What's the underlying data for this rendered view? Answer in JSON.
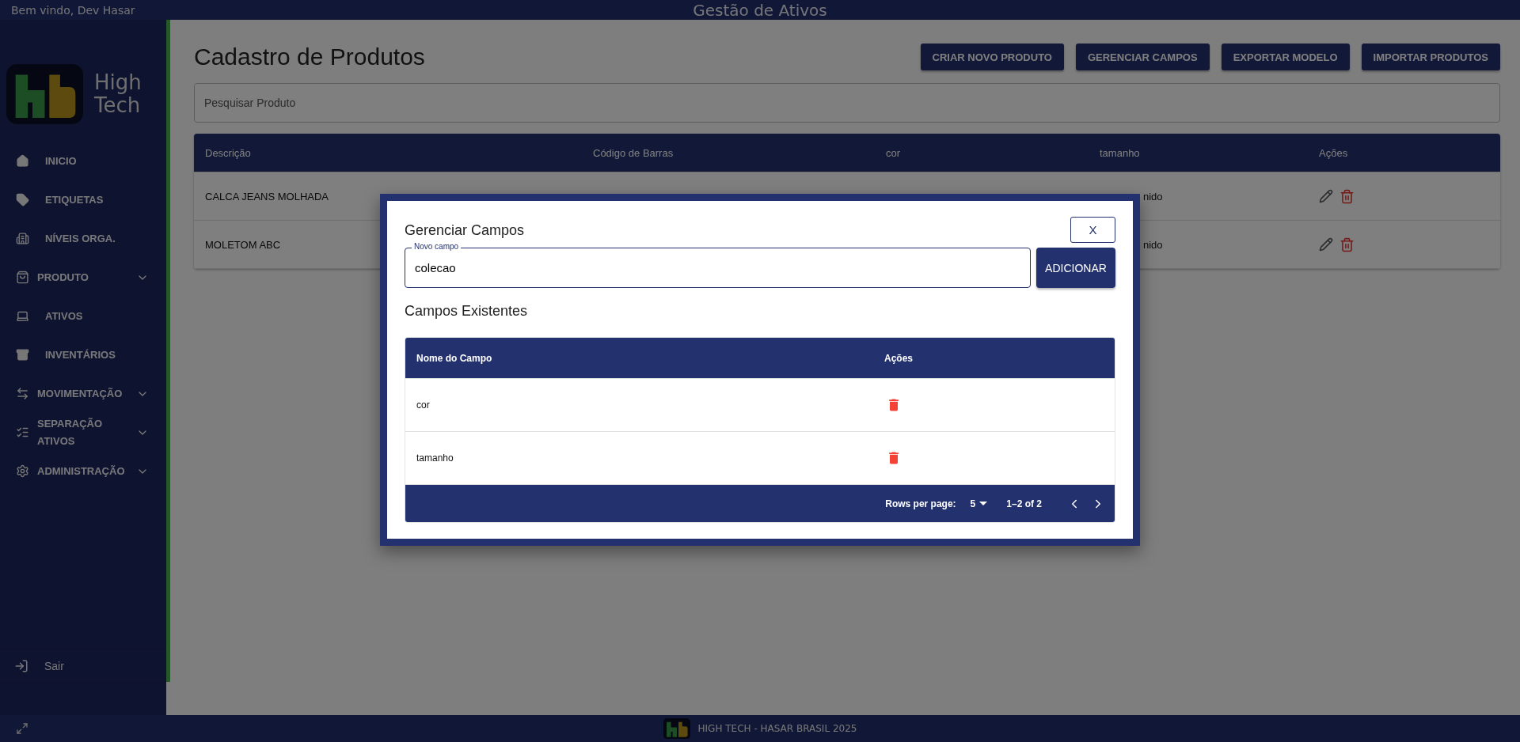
{
  "top_bar": {
    "greeting": "Bem vindo, Dev Hasar",
    "title": "Gestão de Ativos"
  },
  "sidebar": {
    "logo_text": "High Tech",
    "items": [
      {
        "label": "INICIO",
        "expandable": false
      },
      {
        "label": "ETIQUETAS",
        "expandable": false
      },
      {
        "label": "NÍVEIS ORGA.",
        "expandable": false
      },
      {
        "label": "PRODUTO",
        "expandable": true
      },
      {
        "label": "ATIVOS",
        "expandable": false
      },
      {
        "label": "INVENTÁRIOS",
        "expandable": false
      },
      {
        "label": "MOVIMENTAÇÃO",
        "expandable": true
      },
      {
        "label": "SEPARAÇÃO ATIVOS",
        "expandable": true
      },
      {
        "label": "ADMINISTRAÇÃO",
        "expandable": true
      }
    ],
    "logout": "Sair"
  },
  "page": {
    "title": "Cadastro de Produtos",
    "actions": [
      "CRIAR NOVO PRODUTO",
      "GERENCIAR CAMPOS",
      "EXPORTAR MODELO",
      "IMPORTAR PRODUTOS"
    ],
    "search": {
      "placeholder": "Pesquisar Produto"
    },
    "table": {
      "columns": [
        "Descrição",
        "Código de Barras",
        "cor",
        "tamanho",
        "Ações"
      ],
      "rows": [
        {
          "descricao": "CALCA JEANS MOLHADA",
          "tamanho": "nido"
        },
        {
          "descricao": "MOLETOM ABC",
          "tamanho": "nido"
        }
      ]
    }
  },
  "dialog": {
    "title": "Gerenciar Campos",
    "close": "X",
    "field": {
      "label": "Novo campo",
      "value": "colecao"
    },
    "add_button": "ADICIONAR",
    "section_title": "Campos Existentes",
    "table": {
      "columns": [
        "Nome do Campo",
        "Ações"
      ],
      "rows": [
        "cor",
        "tamanho"
      ]
    },
    "pagination": {
      "rows_per_page_label": "Rows per page:",
      "rows_per_page": "5",
      "range": "1–2 of 2"
    }
  },
  "footer": "HIGH TECH - HASAR BRASIL 2025"
}
